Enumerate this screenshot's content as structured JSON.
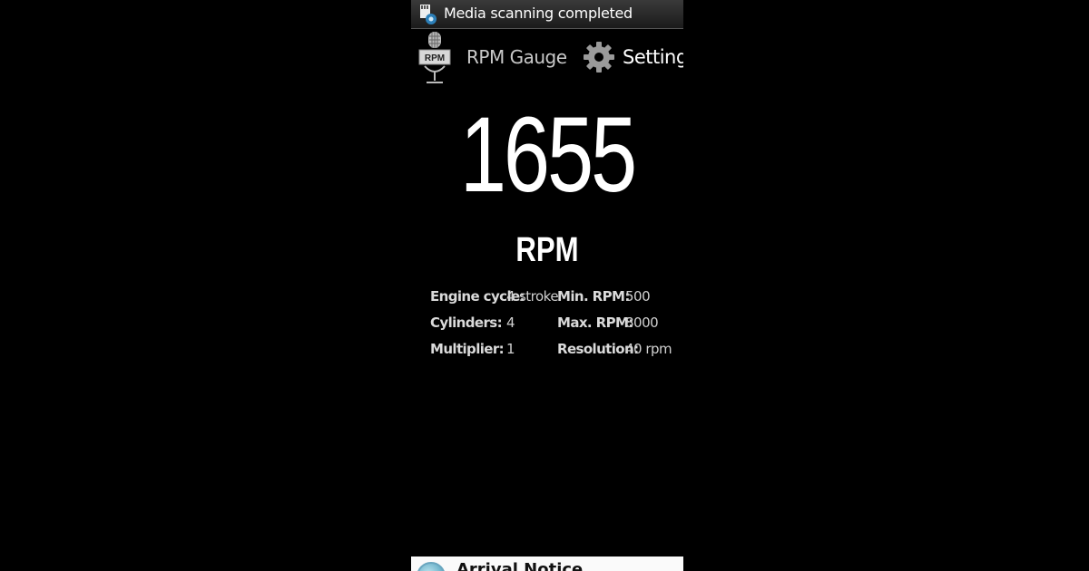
{
  "status_bar": {
    "notification_text": "Media scanning completed",
    "icon": "sd-card-scan-icon"
  },
  "action_bar": {
    "app_icon": "rpm-microphone-icon",
    "app_icon_text": "RPM",
    "app_title": "RPM Gauge",
    "settings_icon": "gear-icon",
    "settings_label": "Settings"
  },
  "readout": {
    "rpm_value": "1655",
    "unit": "RPM"
  },
  "info": {
    "rows": [
      {
        "label1": "Engine cycle:",
        "value1": "4-stroke",
        "label2": "Min. RPM:",
        "value2": "500"
      },
      {
        "label1": "Cylinders:",
        "value1": "4",
        "label2": "Max. RPM:",
        "value2": "8000"
      },
      {
        "label1": "Multiplier:",
        "value1": "1",
        "label2": "Resolution:",
        "value2": "40 rpm"
      }
    ]
  },
  "bottom_notice": {
    "title": "Arrival Notice"
  },
  "colors": {
    "background": "#000000",
    "text": "#ffffff",
    "info_text": "#d4d4d4"
  }
}
